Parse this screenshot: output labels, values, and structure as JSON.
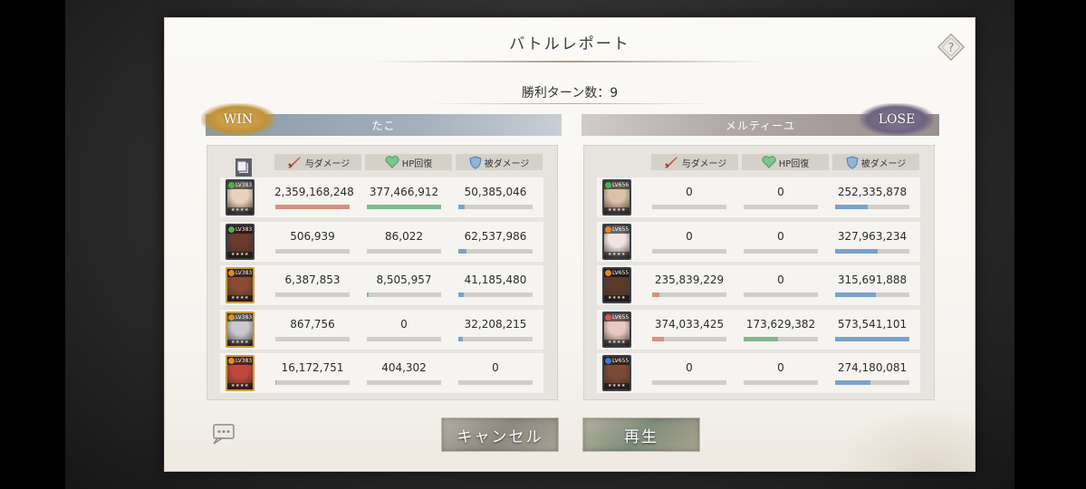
{
  "dialog": {
    "title": "バトルレポート",
    "turns_label": "勝利ターン数：9"
  },
  "left_team": {
    "result": "WIN",
    "name": "たこ",
    "headers": {
      "damage": "与ダメージ",
      "heal": "HP回復",
      "taken": "被ダメージ"
    },
    "rows": [
      {
        "level": "LV383",
        "element_color": "#4caf50",
        "frame": "dark",
        "face": "#e9d3bd",
        "damage": "2,359,168,248",
        "heal": "377,466,912",
        "taken": "50,385,046",
        "damage_pct": 1.0,
        "heal_pct": 1.0,
        "taken_pct": 0.09
      },
      {
        "level": "LV383",
        "element_color": "#4caf50",
        "frame": "dark",
        "face": "#6b3a2e",
        "damage": "506,939",
        "heal": "86,022",
        "taken": "62,537,986",
        "damage_pct": 0.0,
        "heal_pct": 0.0,
        "taken_pct": 0.11
      },
      {
        "level": "LV383",
        "element_color": "#e08a2a",
        "frame": "gold",
        "face": "#8a4a33",
        "damage": "6,387,853",
        "heal": "8,505,957",
        "taken": "41,185,480",
        "damage_pct": 0.0,
        "heal_pct": 0.02,
        "taken_pct": 0.07
      },
      {
        "level": "LV383",
        "element_color": "#e08a2a",
        "frame": "gold",
        "face": "#c9c9d2",
        "damage": "867,756",
        "heal": "0",
        "taken": "32,208,215",
        "damage_pct": 0.0,
        "heal_pct": 0.0,
        "taken_pct": 0.06
      },
      {
        "level": "LV383",
        "element_color": "#e08a2a",
        "frame": "gold",
        "face": "#c0473a",
        "damage": "16,172,751",
        "heal": "404,302",
        "taken": "0",
        "damage_pct": 0.01,
        "heal_pct": 0.0,
        "taken_pct": 0.0
      }
    ]
  },
  "right_team": {
    "result": "LOSE",
    "name": "メルティーユ",
    "headers": {
      "damage": "与ダメージ",
      "heal": "HP回復",
      "taken": "被ダメージ"
    },
    "rows": [
      {
        "level": "LV656",
        "element_color": "#4caf50",
        "frame": "dark",
        "face": "#d9c2a8",
        "damage": "0",
        "heal": "0",
        "taken": "252,335,878",
        "damage_pct": 0.0,
        "heal_pct": 0.0,
        "taken_pct": 0.44
      },
      {
        "level": "LV655",
        "element_color": "#e08a2a",
        "frame": "dark",
        "face": "#efe3e3",
        "damage": "0",
        "heal": "0",
        "taken": "327,963,234",
        "damage_pct": 0.0,
        "heal_pct": 0.0,
        "taken_pct": 0.57
      },
      {
        "level": "LV655",
        "element_color": "#e08a2a",
        "frame": "dark",
        "face": "#5a3b2a",
        "damage": "235,839,229",
        "heal": "0",
        "taken": "315,691,888",
        "damage_pct": 0.1,
        "heal_pct": 0.0,
        "taken_pct": 0.55
      },
      {
        "level": "LV655",
        "element_color": "#d9534f",
        "frame": "dark",
        "face": "#e8c9c0",
        "damage": "374,033,425",
        "heal": "173,629,382",
        "taken": "573,541,101",
        "damage_pct": 0.16,
        "heal_pct": 0.46,
        "taken_pct": 1.0
      },
      {
        "level": "LV655",
        "element_color": "#3a7bd5",
        "frame": "dark",
        "face": "#7b4a36",
        "damage": "0",
        "heal": "0",
        "taken": "274,180,081",
        "damage_pct": 0.0,
        "heal_pct": 0.0,
        "taken_pct": 0.48
      }
    ]
  },
  "buttons": {
    "cancel": "キャンセル",
    "play": "再生"
  }
}
